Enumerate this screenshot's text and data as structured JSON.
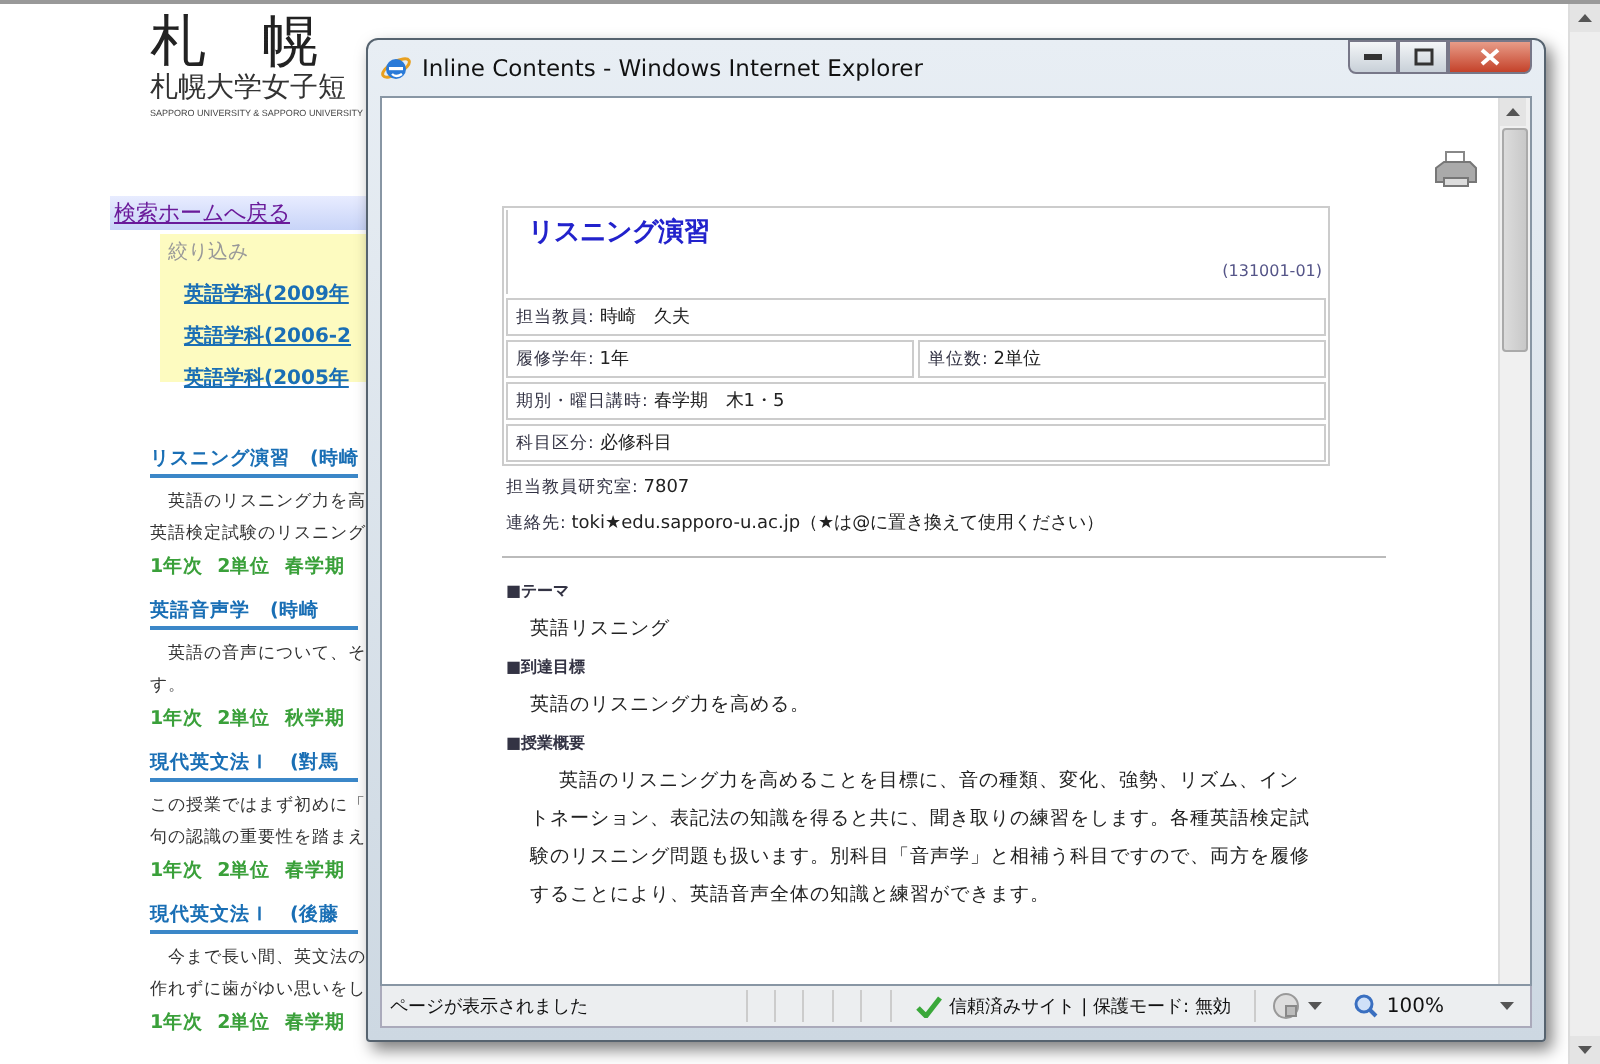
{
  "page": {
    "logo": "札　幌",
    "subtitle": "札幌大学女子短",
    "subtitle_en": "SAPPORO UNIVERSITY & SAPPORO UNIVERSITY",
    "back_link": "検索ホームへ戻る",
    "filter": {
      "heading": "絞り込み",
      "items": [
        "英語学科(2009年",
        "英語学科(2006-2",
        "英語学科(2005年"
      ]
    },
    "courses": [
      {
        "title": "リスニング演習　(時崎",
        "description": [
          "　英語のリスニング力を高",
          "英語検定試験のリスニング"
        ],
        "meta": [
          "1年次",
          "2単位",
          "春学期"
        ]
      },
      {
        "title": "英語音声学　(時崎",
        "description": [
          "　英語の音声について、そ",
          "す。"
        ],
        "meta": [
          "1年次",
          "2単位",
          "秋学期"
        ]
      },
      {
        "title": "現代英文法Ｉ　(對馬",
        "description": [
          "この授業ではまず初めに「",
          "句の認識の重要性を踏まえ"
        ],
        "meta": [
          "1年次",
          "2単位",
          "春学期"
        ]
      },
      {
        "title": "現代英文法Ｉ　(後藤",
        "description": [
          "　今まで長い間、英文法の",
          "作れずに歯がゆい思いをし"
        ],
        "meta": [
          "1年次",
          "2単位",
          "春学期"
        ]
      }
    ]
  },
  "popup": {
    "title": "Inline Contents - Windows Internet Explorer",
    "course": {
      "title": "リスニング演習",
      "code": "(131001-01)",
      "rows": [
        [
          {
            "label": "担当教員:",
            "value": "時崎　久夫"
          }
        ],
        [
          {
            "label": "履修学年:",
            "value": "1年"
          },
          {
            "label": "単位数:",
            "value": "2単位"
          }
        ],
        [
          {
            "label": "期別・曜日講時:",
            "value": "春学期　木1・5"
          }
        ],
        [
          {
            "label": "科目区分:",
            "value": "必修科目"
          }
        ]
      ],
      "office": {
        "label": "担当教員研究室:",
        "value": "7807"
      },
      "contact": {
        "label": "連絡先:",
        "value": "toki★edu.sapporo-u.ac.jp（★は@に置き換えて使用ください）"
      },
      "sections": [
        {
          "heading": "■テーマ",
          "body": "英語リスニング",
          "kind": "plain"
        },
        {
          "heading": "■到達目標",
          "body": "英語のリスニング力を高める。",
          "kind": "plain"
        },
        {
          "heading": "■授業概要",
          "body": "英語のリスニング力を高めることを目標に、音の種類、変化、強勢、リズム、イントネーション、表記法の知識を得ると共に、聞き取りの練習をします。各種英語検定試験のリスニング問題も扱います。別科目「音声学」と相補う科目ですので、両方を履修することにより、英語音声全体の知識と練習ができます。",
          "kind": "indented"
        }
      ]
    },
    "status_bar": {
      "message": "ページが表示されました",
      "zone": "信頼済みサイト | 保護モード: 無効",
      "zoom": "100%"
    }
  }
}
